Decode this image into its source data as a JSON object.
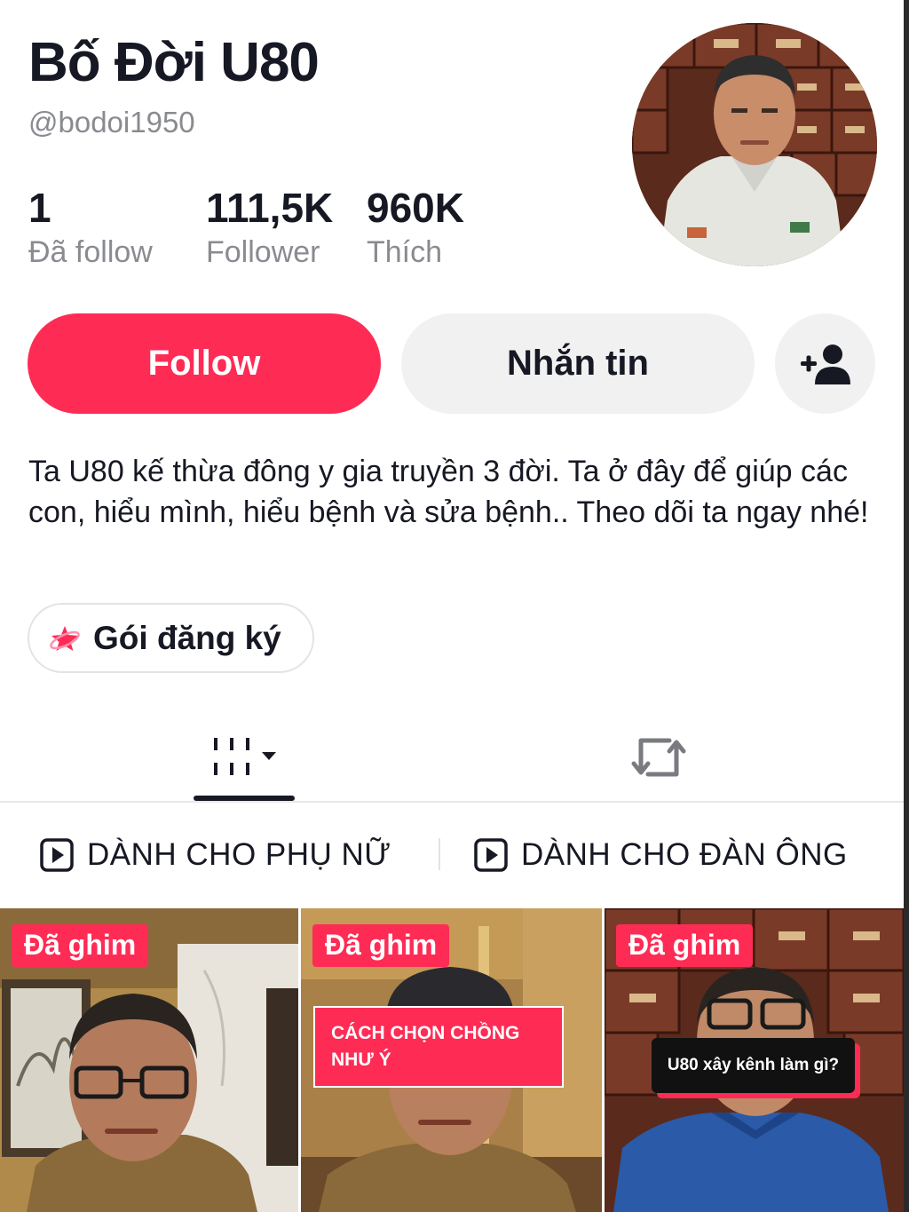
{
  "profile": {
    "display_name": "Bố Đời U80",
    "username": "@bodoi1950"
  },
  "stats": {
    "following": {
      "value": "1",
      "label": "Đã follow"
    },
    "followers": {
      "value": "111,5K",
      "label": "Follower"
    },
    "likes": {
      "value": "960K",
      "label": "Thích"
    }
  },
  "actions": {
    "follow_label": "Follow",
    "message_label": "Nhắn tin",
    "add_friend_icon": "person-plus-icon"
  },
  "bio": "Ta U80 kế thừa đông y gia truyền 3 đời. Ta ở đây để giúp các con, hiểu mình, hiểu bệnh và sửa bệnh.. Theo dõi ta ngay nhé!",
  "subscription": {
    "label": "Gói đăng ký",
    "icon": "subscription-star-icon"
  },
  "tabs": [
    {
      "name": "videos",
      "icon": "grid-icon",
      "active": true
    },
    {
      "name": "reposts",
      "icon": "repost-icon",
      "active": false
    }
  ],
  "playlists": [
    {
      "label": "DÀNH CHO PHỤ NỮ",
      "icon": "playlist-play-icon"
    },
    {
      "label": "DÀNH CHO ĐÀN ÔNG",
      "icon": "playlist-play-icon"
    }
  ],
  "videos": [
    {
      "badge": "Đã ghim",
      "caption": ""
    },
    {
      "badge": "Đã ghim",
      "caption_line1": "CÁCH CHỌN CHỒNG",
      "caption_line2": "NHƯ Ý"
    },
    {
      "badge": "Đã ghim",
      "caption": "U80 xây kênh làm gì?"
    }
  ],
  "colors": {
    "accent": "#fe2c55",
    "text": "#161823",
    "muted": "#8a8b91",
    "button_gray": "#f1f1f2"
  }
}
